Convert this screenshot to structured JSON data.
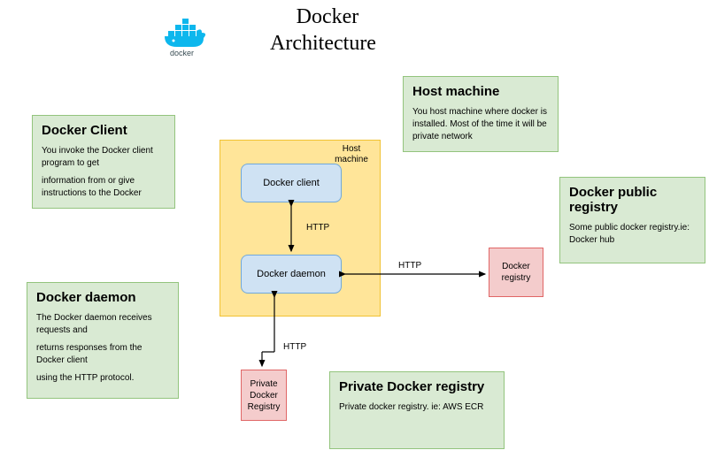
{
  "title_line1": "Docker",
  "title_line2": "Architecture",
  "logo_text": "docker",
  "host_box_label": "Host\nmachine",
  "client_node": "Docker client",
  "daemon_node": "Docker daemon",
  "public_registry_node": "Docker\nregistry",
  "private_registry_node": "Private\nDocker\nRegistry",
  "http_label": "HTTP",
  "info_boxes": {
    "client": {
      "title": "Docker Client",
      "p1": "You invoke the Docker client program to get",
      "p2": "information from or give instructions to the Docker"
    },
    "host": {
      "title": "Host machine",
      "p1": "You host machine where docker is installed. Most of the time it will be private network"
    },
    "public_registry": {
      "title": "Docker public registry",
      "p1": "Some public docker registry.ie: Docker hub"
    },
    "daemon": {
      "title": "Docker daemon",
      "p1": "The Docker daemon receives requests and",
      "p2": "returns responses from the Docker client",
      "p3": "using the HTTP protocol."
    },
    "private_registry": {
      "title": "Private Docker registry",
      "p1": "Private docker registry. ie: AWS ECR"
    }
  }
}
